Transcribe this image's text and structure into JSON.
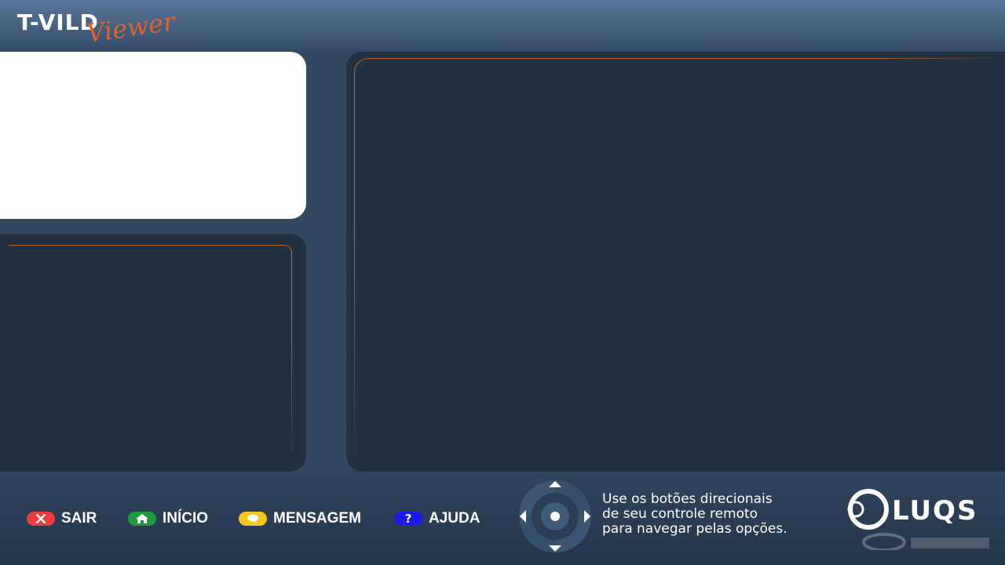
{
  "header": {
    "logo_main": "T-VILD",
    "logo_script": "Viewer"
  },
  "footer": {
    "keys": [
      {
        "label": "SAIR",
        "color": "#ee3b3b",
        "icon": "close-icon"
      },
      {
        "label": "INÍCIO",
        "color": "#1f9a3b",
        "icon": "home-icon"
      },
      {
        "label": "MENSAGEM",
        "color": "#f4c61c",
        "icon": "chat-bubble-icon"
      },
      {
        "label": "AJUDA",
        "color": "#1a1aee",
        "icon": "question-icon",
        "glyph": "?"
      }
    ],
    "hint_lines": [
      "Use os botões direcionais",
      "de seu controle remoto",
      "para navegar pelas opções."
    ],
    "brand": "LUQS"
  },
  "colors": {
    "accent": "#e0622d",
    "panel_dark": "#223142",
    "background": "#314862"
  }
}
